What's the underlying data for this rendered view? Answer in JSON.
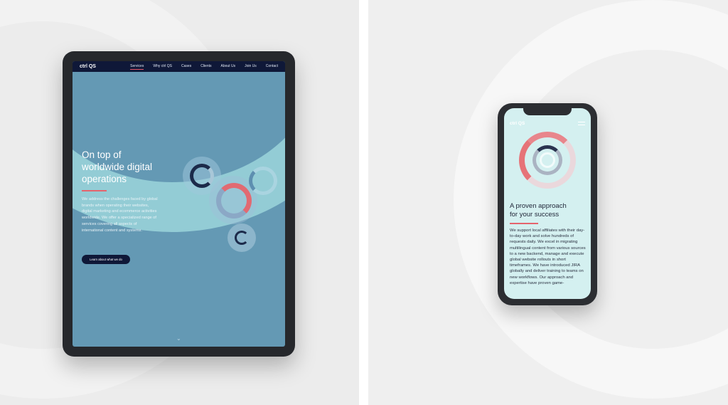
{
  "tablet": {
    "logo": "ctrl QS",
    "nav": [
      "Services",
      "Why ctrl QS",
      "Cases",
      "Clients",
      "About Us",
      "Join Us",
      "Contact"
    ],
    "active_nav": "Services",
    "heading_lines": [
      "On top of",
      "worldwide digital",
      "operations"
    ],
    "body": "We address the challenges faced by global brands when operating their websites, digital marketing and ecommerce activities worldwide. We offer a specialized range of services covering all aspects of international content and systems.",
    "cta": "Learn about what we do",
    "scroll_icon": "chevron-down"
  },
  "phone": {
    "logo": "ctrl QS",
    "menu_icon": "hamburger",
    "heading_lines": [
      "A proven approach",
      "for your success"
    ],
    "body": "We support local affiliates with their day-to-day work and solve hundreds of requests daily. We excel in migrating multilingual content from various sources to a new backend, manage and execute global website rollouts in short timeframes. We have introduced JIRA globally and deliver training to teams on new workflows. Our approach and expertise have proven game-"
  },
  "colors": {
    "navy": "#0f1838",
    "accent": "#e5646d",
    "tablet_bg": "#6499b4",
    "phone_bg": "#d4f0f0"
  }
}
